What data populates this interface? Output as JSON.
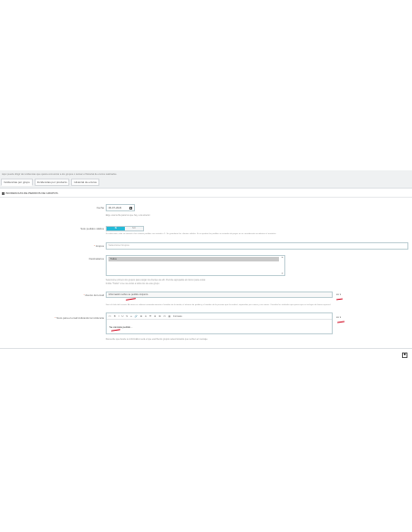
{
  "intro_text": "Aquí puede dirigir de incidencias que quiera comunicar a los grupos o revisar el historial de envíos realizados.",
  "tabs": [
    {
      "label": "Incidencias por grupo"
    },
    {
      "label": "Incidencias por producto"
    },
    {
      "label": "Historial de envíos"
    }
  ],
  "panel": {
    "title": "INCIDENCIAS DE PEDIDOS DE GRUPOS"
  },
  "fields": {
    "date": {
      "label": "Fecha",
      "value": "30-07-2024",
      "help": "Elige una fecha para los que hay, a la anterior."
    },
    "pedidos_validos": {
      "label": "Solo pedidos válidos",
      "on": "SÍ",
      "off": "NO",
      "help": "Si selecciona, solo se enviará a los clientes pedidos con estado = 1. Se guardarán los clientes válidos. Si se quedan los pedidos en estados de pagos no se considerarán incidentes al enviarlas."
    },
    "grupos": {
      "label": "Grupos",
      "required": "*",
      "placeholder": "Seleccionar Grupos"
    },
    "destinatarios": {
      "label": "Destinatarios",
      "selected_option": "Todos",
      "help_1": "Seleccione primero los grupos para cargar los clientes de ahí. Permite agrupados al mismo para enviar.",
      "help_2": "Indica \"Todos\" si se va enviar a todos los de este grupo."
    },
    "asunto": {
      "label": "Asunto del email",
      "required": "*",
      "value": "Información sobre su pedido conjunto",
      "lang": "es",
      "help": "Será el título del asunto. Al enviar se utilizará automáticamente el nombre de la tienda, el número de pedido y el nombre de la persona que lo recibirá, separados por comas y sin comas. Consulte los símbolos que quiera que se incluyan de forma especial."
    },
    "texto": {
      "label": "Texto para el email indicando la incidencia",
      "required": "*",
      "lang": "es",
      "body": "Se cancela pedido...",
      "format_label": "Formats",
      "help": "Recuerde que desde su informático será el que escriba los grupos seleccionados que reciben el mensaje."
    }
  },
  "toolbar_items": [
    "<>",
    "B",
    "I",
    "U",
    "S",
    "≡",
    "🔗",
    "⊞",
    "A",
    "☰",
    "⊟",
    "⊠",
    "⊡",
    "▦"
  ],
  "icons": {
    "panel": "list-icon",
    "calendar": "calendar-icon",
    "save": "save-icon",
    "lang": "chevron-down-icon"
  }
}
